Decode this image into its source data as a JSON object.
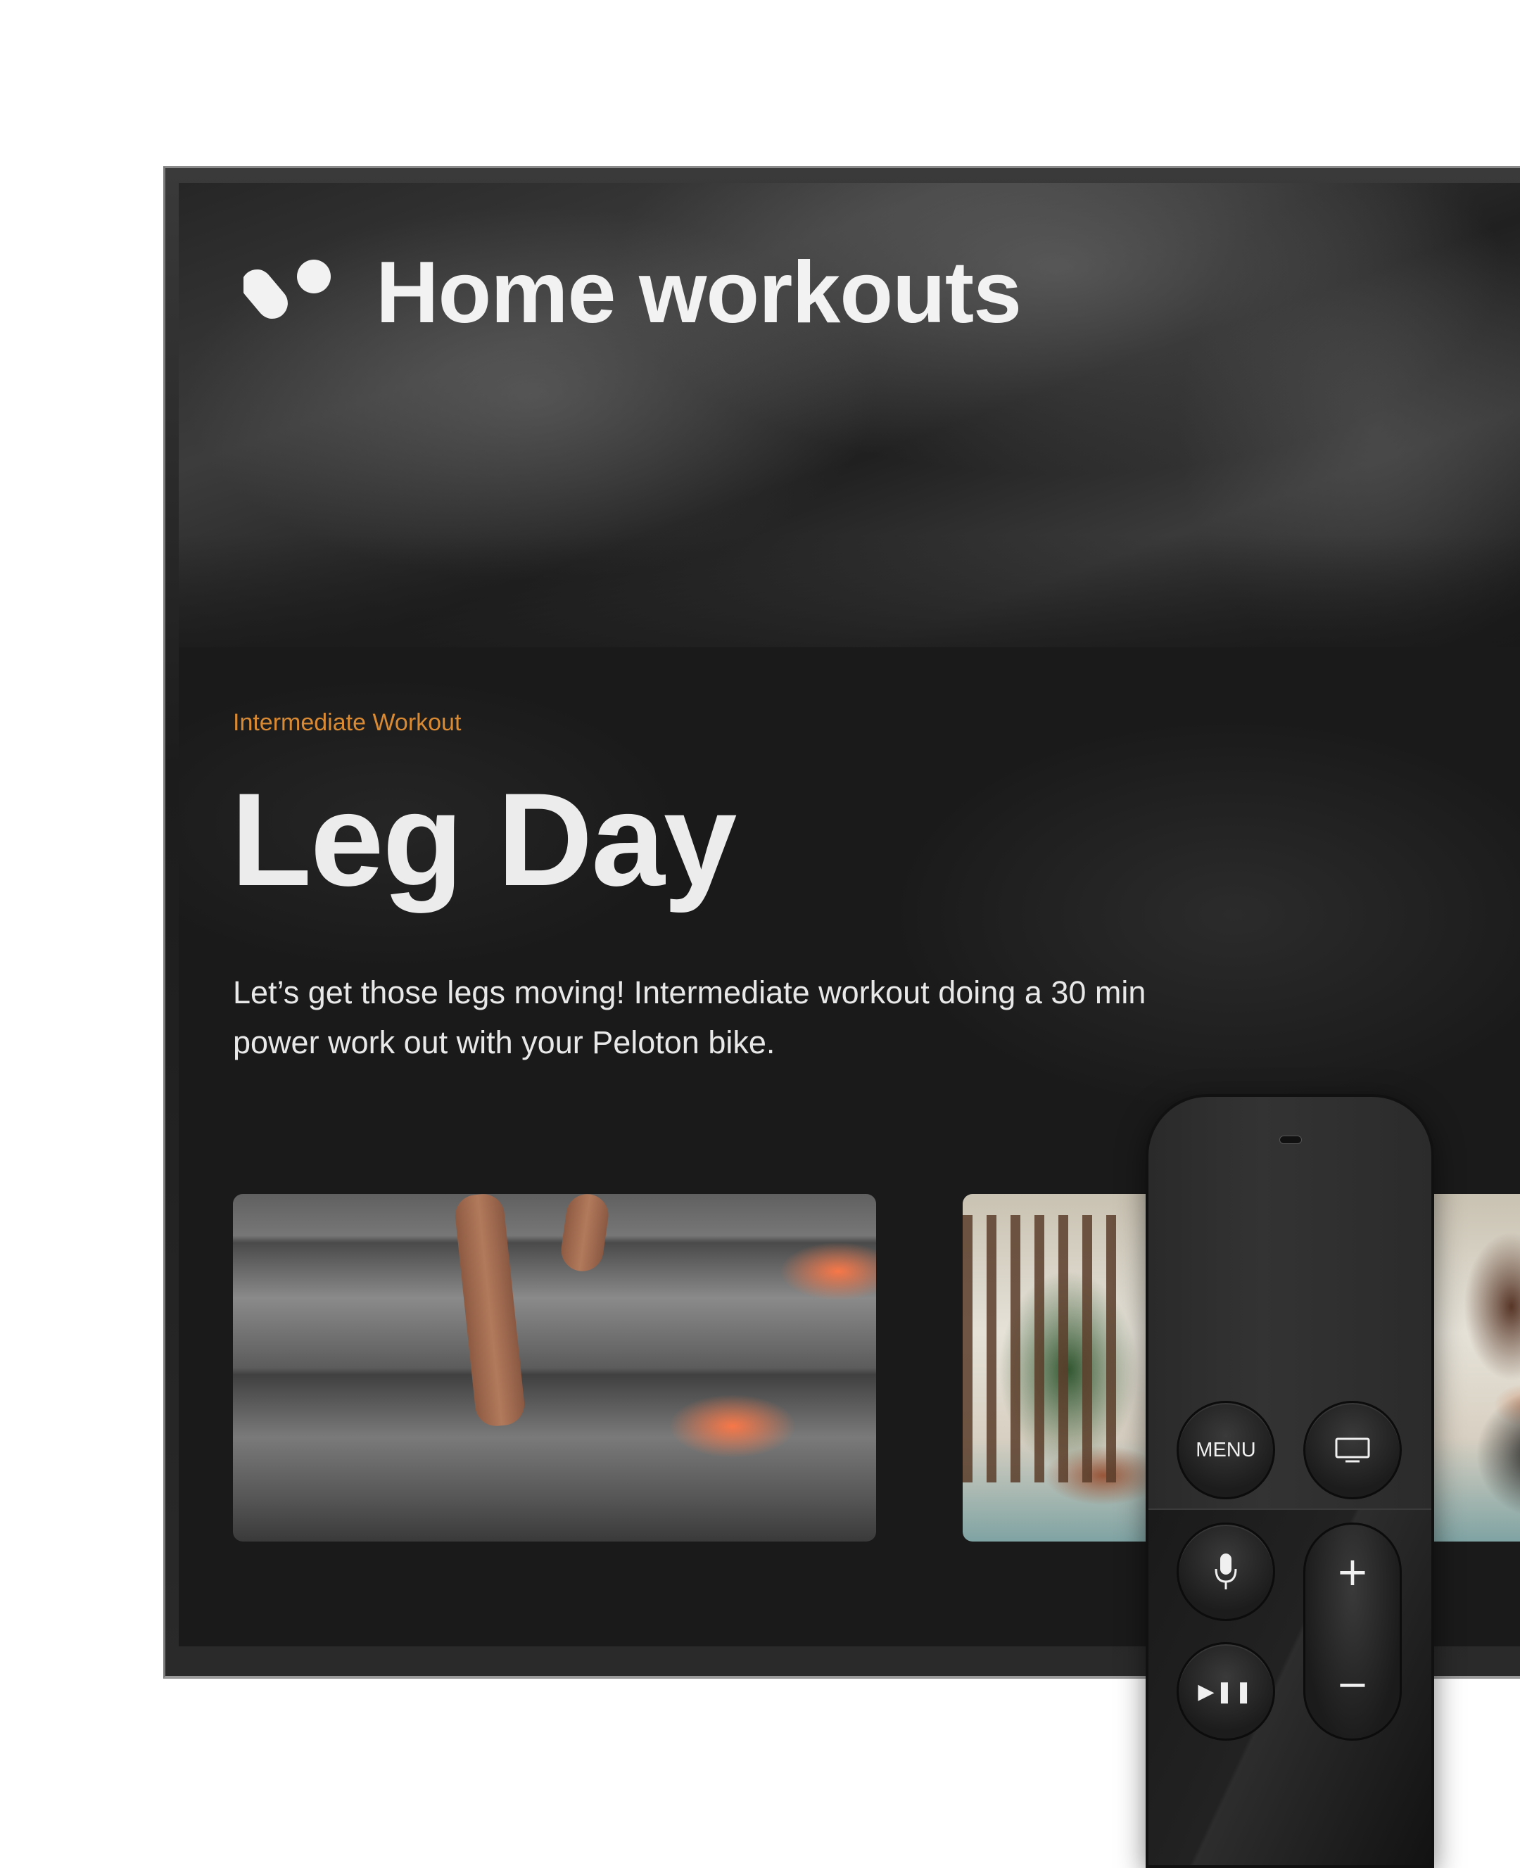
{
  "app": {
    "title": "Home workouts",
    "logo_icon": "logo-icon"
  },
  "featured": {
    "level_label": "Intermediate Workout",
    "title": "Leg Day",
    "description": "Let’s get those legs moving! Intermediate workout doing a 30 min power work out with your Peloton bike."
  },
  "cards": [
    {
      "image": "stairs-running-shoes-image"
    },
    {
      "image": "yoga-mat-plant-image"
    }
  ],
  "remote": {
    "menu_label": "MENU",
    "tv_icon": "tv-icon",
    "mic_icon": "microphone-icon",
    "play_pause_label": "▶︎❚❚",
    "volume_up_label": "+",
    "volume_down_label": "−"
  },
  "colors": {
    "accent": "#d98a32",
    "background": "#1a1a1a",
    "text": "#ececec"
  }
}
